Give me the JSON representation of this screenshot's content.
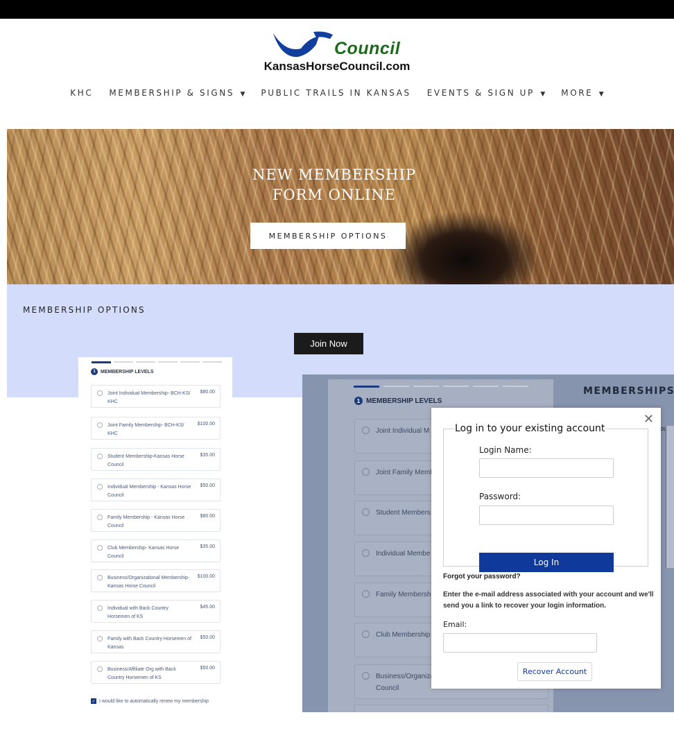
{
  "logo": {
    "word": "Council",
    "url": "KansasHorseCouncil.com"
  },
  "nav": {
    "items": [
      {
        "label": "KHC",
        "caret": false
      },
      {
        "label": "MEMBERSHIP & SIGNS",
        "caret": true
      },
      {
        "label": "PUBLIC TRAILS IN KANSAS",
        "caret": false
      },
      {
        "label": "EVENTS & SIGN UP",
        "caret": true
      },
      {
        "label": "MORE",
        "caret": true
      }
    ]
  },
  "hero": {
    "title_line1": "NEW MEMBERSHIP",
    "title_line2": "FORM ONLINE",
    "button": "MEMBERSHIP OPTIONS"
  },
  "section": {
    "title": "MEMBERSHIP OPTIONS",
    "join_button": "Join Now"
  },
  "widget": {
    "step_number": "1",
    "levels_header": "MEMBERSHIP LEVELS",
    "options": [
      {
        "name": "Joint Individual Membership- BCH-KS/ KHC",
        "price": "$80.00"
      },
      {
        "name": "Joint Family Membership- BCH-KS/ KHC",
        "price": "$100.00"
      },
      {
        "name": "Student Membership-Kansas Horse Council",
        "price": "$35.00"
      },
      {
        "name": "Individual Membership - Kansas Horse Council",
        "price": "$50.00"
      },
      {
        "name": "Family Membership - Kansas Horse Council",
        "price": "$80.00"
      },
      {
        "name": "Club Membership- Kansas Horse Council",
        "price": "$35.00"
      },
      {
        "name": "Business/Organizational Membership-Kansas Horse Council",
        "price": "$100.00"
      },
      {
        "name": "Individual with Back Country Horsemen of KS",
        "price": "$45.00"
      },
      {
        "name": "Family with Back Country Horsemen of Kansas",
        "price": "$50.00"
      },
      {
        "name": "Business/Affiliate Org with Back Country Horsemen of KS",
        "price": "$50.00"
      }
    ],
    "renew_label": "I would like to automatically renew my membership"
  },
  "right_widget": {
    "title": "MEMBERSHIPS",
    "levels_header": "MEMBERSHIP LEVELS",
    "step_number": "1",
    "side_text": "ou s",
    "options": [
      {
        "name": "Joint Individual M KS/ KHC"
      },
      {
        "name": "Joint Family Memb KHC"
      },
      {
        "name": "Student Members Council"
      },
      {
        "name": "Individual Membe Horse Council"
      },
      {
        "name": "Family Membersh Council"
      },
      {
        "name": "Club Membership Council"
      },
      {
        "name": "Business/Organiza Membership-Kansas Horse Council"
      }
    ]
  },
  "modal": {
    "legend": "Log in to your existing account",
    "login_name_label": "Login Name:",
    "password_label": "Password:",
    "login_button": "Log In",
    "forgot": "Forgot your password?",
    "help_text": "Enter the e-mail address associated with your account and we'll send you a link to recover your login information.",
    "email_label": "Email:",
    "recover_button": "Recover Account",
    "close": "✕"
  }
}
